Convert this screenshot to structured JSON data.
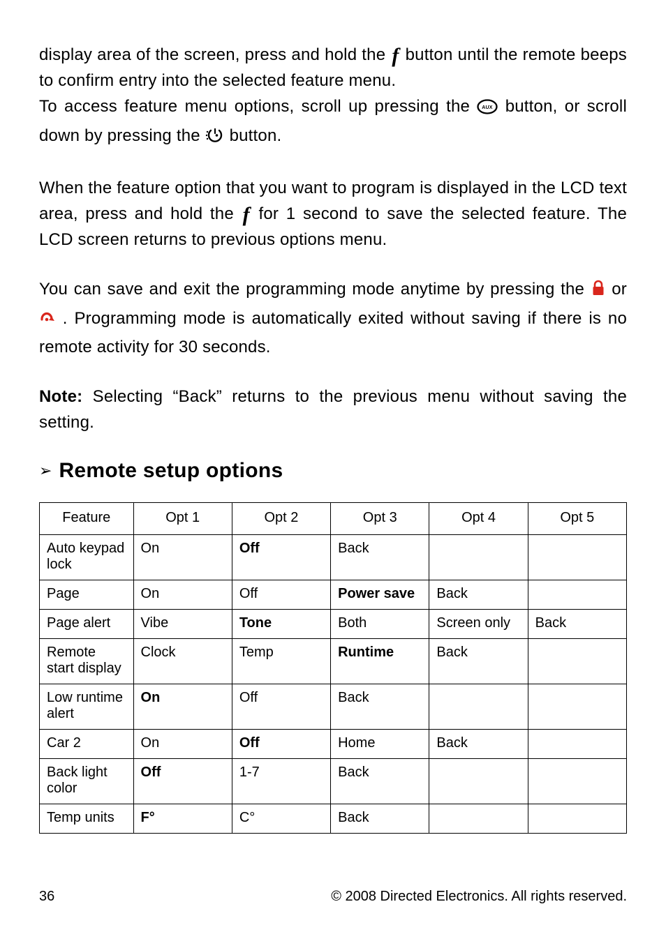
{
  "para1": {
    "t1": "display area of the screen, press and hold the ",
    "t2": " button until the remote beeps to confirm entry into the selected feature menu.",
    "t3": "To access feature menu options, scroll up pressing the ",
    "t4": " button, or scroll down by pressing the ",
    "t5": " button."
  },
  "para2": {
    "t1": "When the feature option that you want to program is displayed in the LCD text area, press and hold the ",
    "t2": " for 1 second to save the selected feature. The LCD screen returns to previous options menu."
  },
  "para3": {
    "t1": "You can save and exit the programming mode anytime by pressing the ",
    "t2": " or ",
    "t3": ". Programming mode is automatically exited without sav­ing if there is no remote activity for 30 seconds."
  },
  "note": {
    "lead": "Note:",
    "body": " Selecting “Back” returns to the previous menu without saving the setting."
  },
  "icons": {
    "f": "f",
    "aux_label": "AUX"
  },
  "section": {
    "arrow": "➢",
    "title": "Remote setup options"
  },
  "table": {
    "headers": [
      "Feature",
      "Opt 1",
      "Opt 2",
      "Opt 3",
      "Opt 4",
      "Opt 5"
    ],
    "rows": [
      {
        "cells": [
          "Auto keypad lock",
          "On",
          "Off",
          "Back",
          "",
          ""
        ],
        "bold": [
          false,
          false,
          true,
          false,
          false,
          false
        ]
      },
      {
        "cells": [
          "Page",
          "On",
          "Off",
          "Power save",
          "Back",
          ""
        ],
        "bold": [
          false,
          false,
          false,
          true,
          false,
          false
        ]
      },
      {
        "cells": [
          "Page alert",
          "Vibe",
          "Tone",
          "Both",
          "Screen only",
          "Back"
        ],
        "bold": [
          false,
          false,
          true,
          false,
          false,
          false
        ]
      },
      {
        "cells": [
          "Remote start display",
          "Clock",
          "Temp",
          "Runtime",
          "Back",
          ""
        ],
        "bold": [
          false,
          false,
          false,
          true,
          false,
          false
        ]
      },
      {
        "cells": [
          "Low runtime alert",
          "On",
          "Off",
          "Back",
          "",
          ""
        ],
        "bold": [
          false,
          true,
          false,
          false,
          false,
          false
        ]
      },
      {
        "cells": [
          "Car 2",
          "On",
          "Off",
          "Home",
          "Back",
          ""
        ],
        "bold": [
          false,
          false,
          true,
          false,
          false,
          false
        ]
      },
      {
        "cells": [
          "Back light color",
          "Off",
          "1-7",
          "Back",
          "",
          ""
        ],
        "bold": [
          false,
          true,
          false,
          false,
          false,
          false
        ]
      },
      {
        "cells": [
          "Temp units",
          "F°",
          "C°",
          "Back",
          "",
          ""
        ],
        "bold": [
          false,
          true,
          false,
          false,
          false,
          false
        ]
      }
    ]
  },
  "footer": {
    "page": "36",
    "copyright": "© 2008 Directed Electronics. All rights reserved."
  }
}
